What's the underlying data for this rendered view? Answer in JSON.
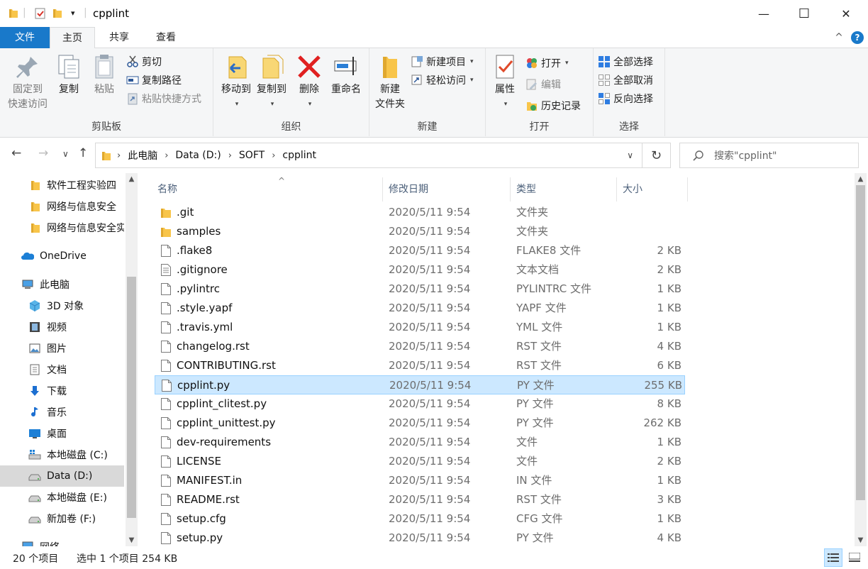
{
  "window": {
    "title": "cpplint",
    "minimize": "—",
    "maximize": "☐",
    "close": "✕"
  },
  "ribbon_tabs": {
    "file": "文件",
    "home": "主页",
    "share": "共享",
    "view": "查看",
    "collapse": "^",
    "help": "?"
  },
  "ribbon": {
    "clipboard": {
      "label": "剪贴板",
      "pin_line1": "固定到",
      "pin_line2": "快速访问",
      "copy": "复制",
      "paste": "粘贴",
      "cut": "剪切",
      "copy_path": "复制路径",
      "paste_shortcut": "粘贴快捷方式"
    },
    "organize": {
      "label": "组织",
      "move_to": "移动到",
      "copy_to": "复制到",
      "delete": "删除",
      "rename": "重命名"
    },
    "new": {
      "label": "新建",
      "new_folder_line1": "新建",
      "new_folder_line2": "文件夹",
      "new_item": "新建项目",
      "easy_access": "轻松访问"
    },
    "open": {
      "label": "打开",
      "properties": "属性",
      "open": "打开",
      "edit": "编辑",
      "history": "历史记录"
    },
    "select": {
      "label": "选择",
      "select_all": "全部选择",
      "select_none": "全部取消",
      "invert": "反向选择"
    }
  },
  "address": {
    "back": "←",
    "forward": "→",
    "recent": "∨",
    "up": "↑",
    "crumbs": [
      "此电脑",
      "Data (D:)",
      "SOFT",
      "cpplint"
    ],
    "separator": "›",
    "dropdown": "∨",
    "refresh": "↻",
    "search_placeholder": "搜索\"cpplint\""
  },
  "nav_pane": {
    "items": [
      {
        "label": "软件工程实验四"
      },
      {
        "label": "网络与信息安全"
      },
      {
        "label": "网络与信息安全实"
      },
      {
        "label": "OneDrive"
      },
      {
        "label": "此电脑"
      },
      {
        "label": "3D 对象"
      },
      {
        "label": "视频"
      },
      {
        "label": "图片"
      },
      {
        "label": "文档"
      },
      {
        "label": "下载"
      },
      {
        "label": "音乐"
      },
      {
        "label": "桌面"
      },
      {
        "label": "本地磁盘 (C:)"
      },
      {
        "label": "Data (D:)"
      },
      {
        "label": "本地磁盘 (E:)"
      },
      {
        "label": "新加卷 (F:)"
      },
      {
        "label": "网络"
      }
    ],
    "selected": "Data (D:)"
  },
  "columns": {
    "name": "名称",
    "date": "修改日期",
    "type": "类型",
    "size": "大小",
    "sort_indicator": "^"
  },
  "files": [
    {
      "name": ".git",
      "date": "2020/5/11 9:54",
      "type": "文件夹",
      "size": "",
      "kind": "folder"
    },
    {
      "name": "samples",
      "date": "2020/5/11 9:54",
      "type": "文件夹",
      "size": "",
      "kind": "folder"
    },
    {
      "name": ".flake8",
      "date": "2020/5/11 9:54",
      "type": "FLAKE8 文件",
      "size": "2 KB",
      "kind": "file"
    },
    {
      "name": ".gitignore",
      "date": "2020/5/11 9:54",
      "type": "文本文档",
      "size": "2 KB",
      "kind": "text"
    },
    {
      "name": ".pylintrc",
      "date": "2020/5/11 9:54",
      "type": "PYLINTRC 文件",
      "size": "1 KB",
      "kind": "file"
    },
    {
      "name": ".style.yapf",
      "date": "2020/5/11 9:54",
      "type": "YAPF 文件",
      "size": "1 KB",
      "kind": "file"
    },
    {
      "name": ".travis.yml",
      "date": "2020/5/11 9:54",
      "type": "YML 文件",
      "size": "1 KB",
      "kind": "file"
    },
    {
      "name": "changelog.rst",
      "date": "2020/5/11 9:54",
      "type": "RST 文件",
      "size": "4 KB",
      "kind": "file"
    },
    {
      "name": "CONTRIBUTING.rst",
      "date": "2020/5/11 9:54",
      "type": "RST 文件",
      "size": "6 KB",
      "kind": "file"
    },
    {
      "name": "cpplint.py",
      "date": "2020/5/11 9:54",
      "type": "PY 文件",
      "size": "255 KB",
      "kind": "file"
    },
    {
      "name": "cpplint_clitest.py",
      "date": "2020/5/11 9:54",
      "type": "PY 文件",
      "size": "8 KB",
      "kind": "file"
    },
    {
      "name": "cpplint_unittest.py",
      "date": "2020/5/11 9:54",
      "type": "PY 文件",
      "size": "262 KB",
      "kind": "file"
    },
    {
      "name": "dev-requirements",
      "date": "2020/5/11 9:54",
      "type": "文件",
      "size": "1 KB",
      "kind": "file"
    },
    {
      "name": "LICENSE",
      "date": "2020/5/11 9:54",
      "type": "文件",
      "size": "2 KB",
      "kind": "file"
    },
    {
      "name": "MANIFEST.in",
      "date": "2020/5/11 9:54",
      "type": "IN 文件",
      "size": "1 KB",
      "kind": "file"
    },
    {
      "name": "README.rst",
      "date": "2020/5/11 9:54",
      "type": "RST 文件",
      "size": "3 KB",
      "kind": "file"
    },
    {
      "name": "setup.cfg",
      "date": "2020/5/11 9:54",
      "type": "CFG 文件",
      "size": "1 KB",
      "kind": "file"
    },
    {
      "name": "setup.py",
      "date": "2020/5/11 9:54",
      "type": "PY 文件",
      "size": "4 KB",
      "kind": "file"
    }
  ],
  "selected_file": "cpplint.py",
  "status": {
    "count": "20 个项目",
    "selection": "选中 1 个项目  254 KB"
  },
  "colors": {
    "accent": "#1979ca",
    "selection_bg": "#cce8ff",
    "selection_border": "#99d1ff",
    "folder": "#f8c54a"
  }
}
